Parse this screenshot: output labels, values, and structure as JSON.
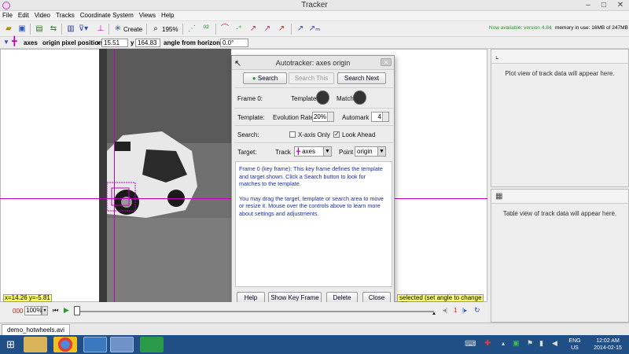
{
  "window": {
    "title": "Tracker",
    "minimize": "–",
    "maximize": "□",
    "close": "✕"
  },
  "menu": [
    "File",
    "Edit",
    "Video",
    "Tracks",
    "Coordinate System",
    "Views",
    "Help"
  ],
  "toolbar": {
    "create_label": "Create",
    "zoom_label": "195%",
    "version_notice": "Now available: version 4.84",
    "memory_label": "memory in use: 16MB of 247MB"
  },
  "axesbar": {
    "track_name": "axes",
    "origin_label": "origin pixel position",
    "x_label": "x",
    "x_value": "15.51",
    "y_label": "y",
    "y_value": "164.83",
    "angle_label": "angle from horizontal",
    "angle_value": "0.0°"
  },
  "right_panels": {
    "plot_msg": "Plot view of track data will appear here.",
    "table_msg": "Table view of track data will appear here."
  },
  "dialog": {
    "title": "Autotracker: axes origin",
    "search": "Search",
    "search_this": "Search This",
    "search_next": "Search Next",
    "frame_label": "Frame 0:",
    "template_label": "Template",
    "match_label": "Match",
    "template_row_label": "Template:",
    "evolution_label": "Evolution Rate",
    "evolution_value": "20%",
    "automark_label": "Automark",
    "automark_value": "4",
    "search_row_label": "Search:",
    "xaxis_only": "X-axis Only",
    "look_ahead": "Look Ahead",
    "target_label": "Target:",
    "track_label": "Track",
    "track_value": "axes",
    "point_label": "Point",
    "point_value": "origin",
    "info_p1": "Frame 0 (key frame): This key frame defines the template and target shown. Click a Search button to look for matches to the template.",
    "info_p2": "You may drag the target, template or search area to move or resize it.  Mouse over the controls above to learn more about settings and adjustments.",
    "help": "Help",
    "show_key_frame": "Show Key Frame",
    "delete": "Delete",
    "close": "Close"
  },
  "readouts": {
    "coords": "x=14.26  y=-5.81",
    "angle_hint": "selected (set angle to change tilt)"
  },
  "playbar": {
    "frame_start": "000",
    "rate": "100%",
    "frame_num": "1"
  },
  "tabs": {
    "file_tab": "demo_hotwheels.avi"
  },
  "taskbar": {
    "lang": "ENG",
    "region": "US",
    "time": "12:02 AM",
    "date": "2014-02-15"
  },
  "colors": {
    "axes": "#c000c0",
    "taskbar": "#1f4f85",
    "highlight": "#ffff66"
  }
}
